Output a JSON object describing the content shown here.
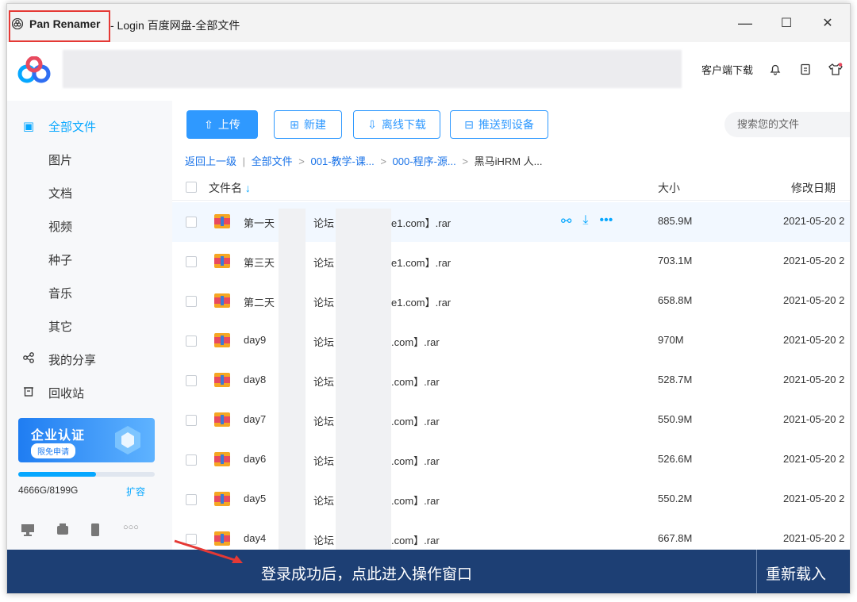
{
  "window": {
    "app_name": "Pan Renamer",
    "title_rest": "- Login 百度网盘-全部文件",
    "controls": {
      "minimize": "—",
      "maximize": "☐",
      "close": "✕"
    }
  },
  "header": {
    "client_download": "客户端下载"
  },
  "sidebar": {
    "all_files": "全部文件",
    "categories": [
      "图片",
      "文档",
      "视频",
      "种子",
      "音乐",
      "其它"
    ],
    "my_share": "我的分享",
    "recycle": "回收站",
    "enterprise": {
      "title": "企业认证",
      "button": "限免申请"
    },
    "quota": {
      "text": "4666G/8199G",
      "expand": "扩容",
      "used_fraction": 0.569
    },
    "device_more": "○○○"
  },
  "toolbar": {
    "upload": "上传",
    "new": "新建",
    "offline_download": "离线下载",
    "push_to_device": "推送到设备",
    "search_placeholder": "搜索您的文件"
  },
  "breadcrumb": {
    "back": "返回上一级",
    "items": [
      "全部文件",
      "001-教学-课...",
      "000-程序-源..."
    ],
    "current": "黑马iHRM 人..."
  },
  "table": {
    "headers": {
      "name": "文件名",
      "size": "大小",
      "date": "修改日期"
    },
    "rows": [
      {
        "name": "第一天",
        "mid": "论坛",
        "ext": "e1.com】.rar",
        "size": "885.9M",
        "date": "2021-05-20 2"
      },
      {
        "name": "第三天",
        "mid": "论坛",
        "ext": "e1.com】.rar",
        "size": "703.1M",
        "date": "2021-05-20 2"
      },
      {
        "name": "第二天",
        "mid": "论坛",
        "ext": "e1.com】.rar",
        "size": "658.8M",
        "date": "2021-05-20 2"
      },
      {
        "name": "day9",
        "mid": "论坛 v",
        "ext": ".com】.rar",
        "size": "970M",
        "date": "2021-05-20 2"
      },
      {
        "name": "day8",
        "mid": "论坛 v",
        "ext": ".com】.rar",
        "size": "528.7M",
        "date": "2021-05-20 2"
      },
      {
        "name": "day7",
        "mid": "论坛 v",
        "ext": ".com】.rar",
        "size": "550.9M",
        "date": "2021-05-20 2"
      },
      {
        "name": "day6",
        "mid": "论坛 v",
        "ext": ".com】.rar",
        "size": "526.6M",
        "date": "2021-05-20 2"
      },
      {
        "name": "day5",
        "mid": "论坛 v",
        "ext": ".com】.rar",
        "size": "550.2M",
        "date": "2021-05-20 2"
      },
      {
        "name": "day4",
        "mid": "论坛 v",
        "ext": ".com】.rar",
        "size": "667.8M",
        "date": "2021-05-20 2"
      }
    ]
  },
  "bottom": {
    "message": "登录成功后，点此进入操作窗口",
    "reload": "重新载入"
  },
  "colors": {
    "accent": "#06a7ff",
    "primary_button": "#2f99ff",
    "bottom_bar": "#1d3f74",
    "highlight_box": "#e53935"
  }
}
